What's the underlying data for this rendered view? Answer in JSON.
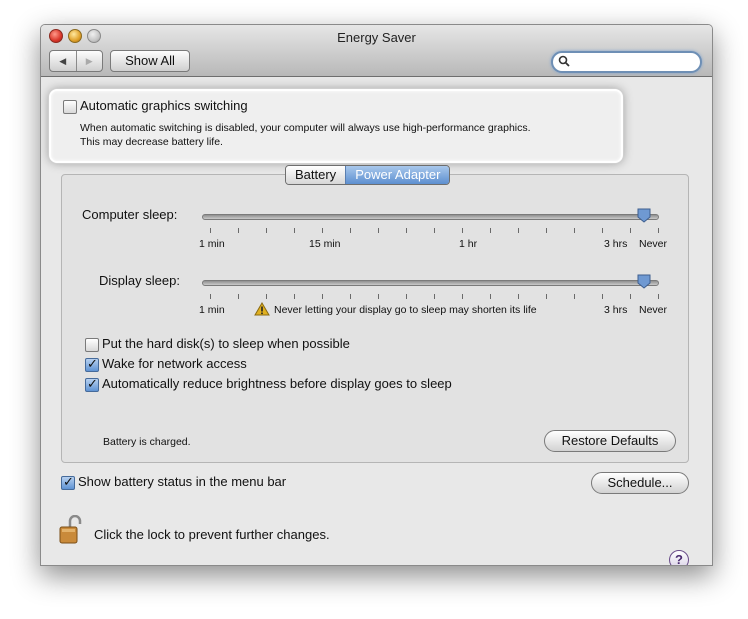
{
  "window": {
    "title": "Energy Saver",
    "nav_back": "◀",
    "nav_forward": "▶",
    "show_all": "Show All",
    "search_placeholder": ""
  },
  "graphics": {
    "label": "Automatic graphics switching",
    "checked": false,
    "description_line1": "When automatic switching is disabled, your computer will always use high-performance graphics.",
    "description_line2": "This may decrease battery life."
  },
  "tabs": [
    {
      "label": "Battery",
      "selected": false
    },
    {
      "label": "Power Adapter",
      "selected": true
    }
  ],
  "computer_sleep": {
    "label": "Computer sleep:",
    "ticks": [
      "1 min",
      "15 min",
      "1 hr",
      "3 hrs",
      "Never"
    ],
    "value": "Never"
  },
  "display_sleep": {
    "label": "Display sleep:",
    "ticks": [
      "1 min",
      "3 hrs",
      "Never"
    ],
    "warning": "Never letting your display go to sleep may shorten its life",
    "value": "Never"
  },
  "options": [
    {
      "label": "Put the hard disk(s) to sleep when possible",
      "checked": false
    },
    {
      "label": "Wake for network access",
      "checked": true
    },
    {
      "label": "Automatically reduce brightness before display goes to sleep",
      "checked": true
    }
  ],
  "status": "Battery is charged.",
  "restore_defaults": "Restore Defaults",
  "show_battery_status": {
    "label": "Show battery status in the menu bar",
    "checked": true
  },
  "schedule": "Schedule...",
  "lock_text": "Click the lock to prevent further changes.",
  "help": "?",
  "colors": {
    "selected_tab": "#5d8fd0",
    "checkbox_on": "#5f93d3",
    "warning": "#e0b020"
  }
}
